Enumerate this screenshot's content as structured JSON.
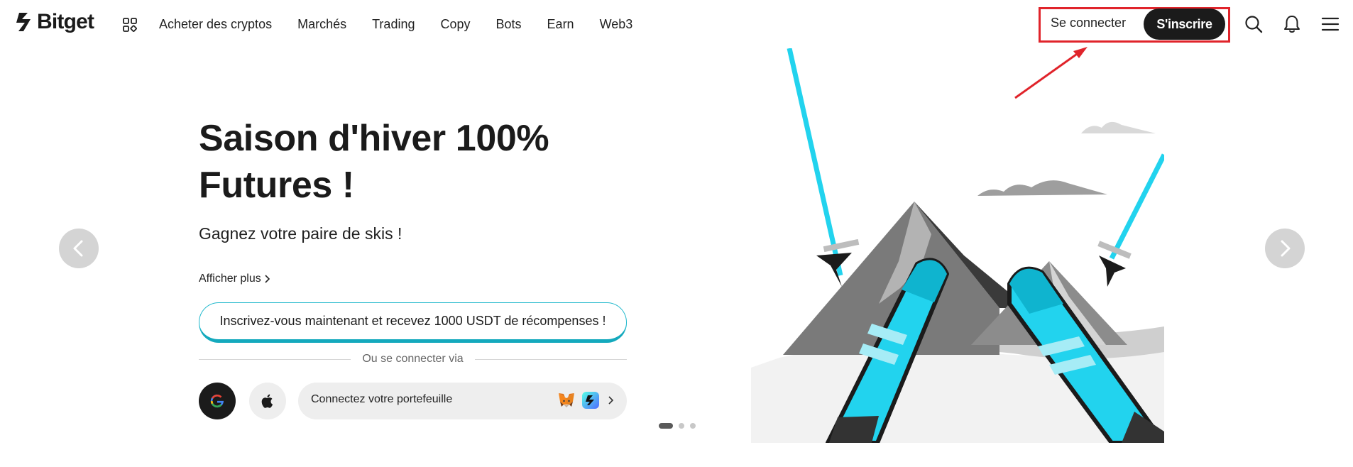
{
  "header": {
    "brand": "Bitget",
    "nav": [
      "Acheter des cryptos",
      "Marchés",
      "Trading",
      "Copy",
      "Bots",
      "Earn",
      "Web3"
    ],
    "login_label": "Se connecter",
    "signup_label": "S'inscrire",
    "icons": [
      "apps-grid-icon",
      "search-icon",
      "bell-icon",
      "menu-icon"
    ]
  },
  "hero": {
    "title": "Saison d'hiver 100% Futures !",
    "subtitle": "Gagnez votre paire de skis !",
    "more_link": "Afficher plus",
    "promo_button": "Inscrivez-vous maintenant et recevez 1000 USDT de récompenses !",
    "divider_text": "Ou se connecter via",
    "wallet_button": "Connectez votre portefeuille",
    "carousel": {
      "slides": 3,
      "active": 1
    }
  },
  "colors": {
    "accent": "#1fb8cc",
    "annotation_red": "#e0242b",
    "primary_dark": "#1b1b1b",
    "ski_cyan": "#22d3ee"
  }
}
